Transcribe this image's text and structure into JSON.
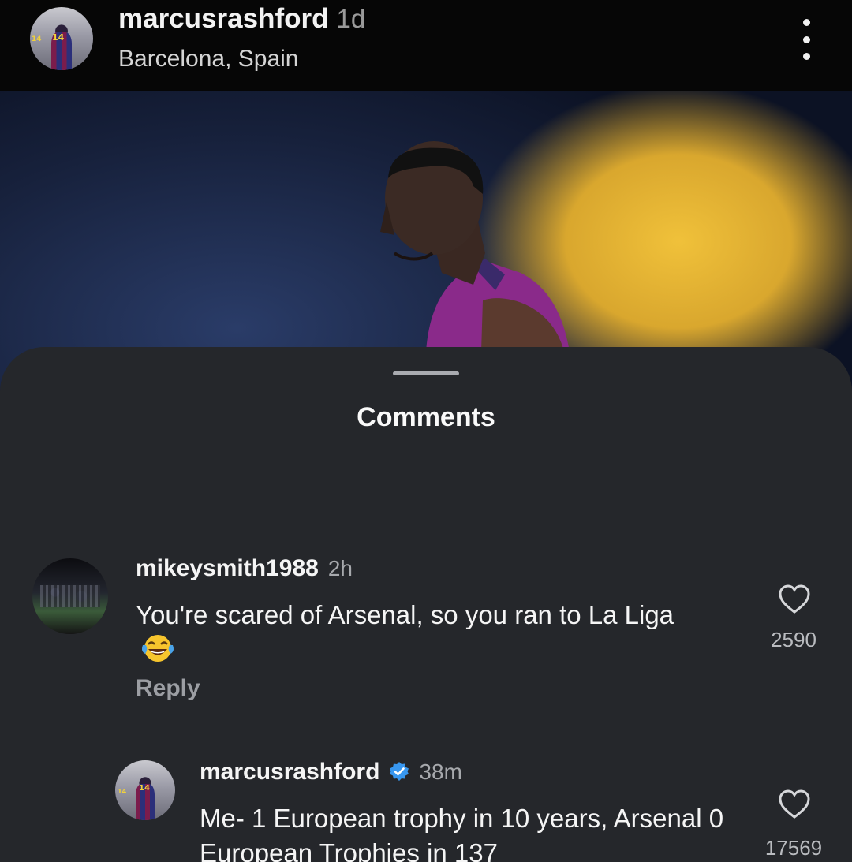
{
  "post": {
    "username": "marcusrashford",
    "time": "1d",
    "location": "Barcelona, Spain",
    "avatar_jersey_number": "14",
    "more_icon": "more-vertical-icon"
  },
  "comments_sheet": {
    "title": "Comments"
  },
  "comments": [
    {
      "username": "mikeysmith1988",
      "time": "2h",
      "text": "You're scared of Arsenal, so you ran to La Liga",
      "emoji": "face-with-tears-of-joy",
      "reply_label": "Reply",
      "likes": "2590",
      "like_icon": "heart-outline-icon"
    },
    {
      "username": "marcusrashford",
      "verified": true,
      "time": "38m",
      "text": "Me- 1 European trophy in 10 years, Arsenal 0 European Trophies in 137",
      "likes": "17569",
      "like_icon": "heart-outline-icon",
      "avatar_jersey_number": "14"
    }
  ],
  "colors": {
    "sheet_background": "#25272b",
    "header_background": "#060606",
    "verified_blue": "#3897f0",
    "secondary_text": "#9c9ea3"
  }
}
